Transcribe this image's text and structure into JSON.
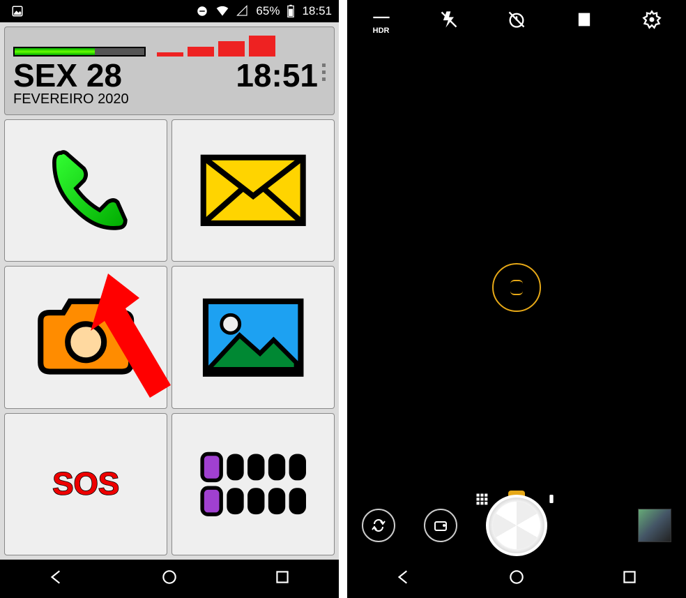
{
  "left": {
    "status": {
      "battery_percent": "65%",
      "time": "18:51"
    },
    "widget": {
      "day_row": "SEX 28",
      "month_row": "FEVEREIRO 2020",
      "time": "18:51"
    },
    "tiles": {
      "phone": "phone-icon",
      "mail": "mail-icon",
      "camera": "camera-icon",
      "gallery": "gallery-icon",
      "sos": "SOS",
      "apps": "apps-grid-icon"
    }
  },
  "right": {
    "top": {
      "hdr": "HDR",
      "flash": "flash-off-icon",
      "timer": "timer-off-icon",
      "ratio": "aspect-ratio-icon",
      "settings": "settings-icon"
    },
    "modes": {
      "grid": "grid-mode",
      "photo": "photo-mode",
      "other": "portrait-mode"
    },
    "bottom": {
      "switch": "switch-camera",
      "filter": "filters",
      "thumb": "last-photo-thumbnail"
    }
  }
}
